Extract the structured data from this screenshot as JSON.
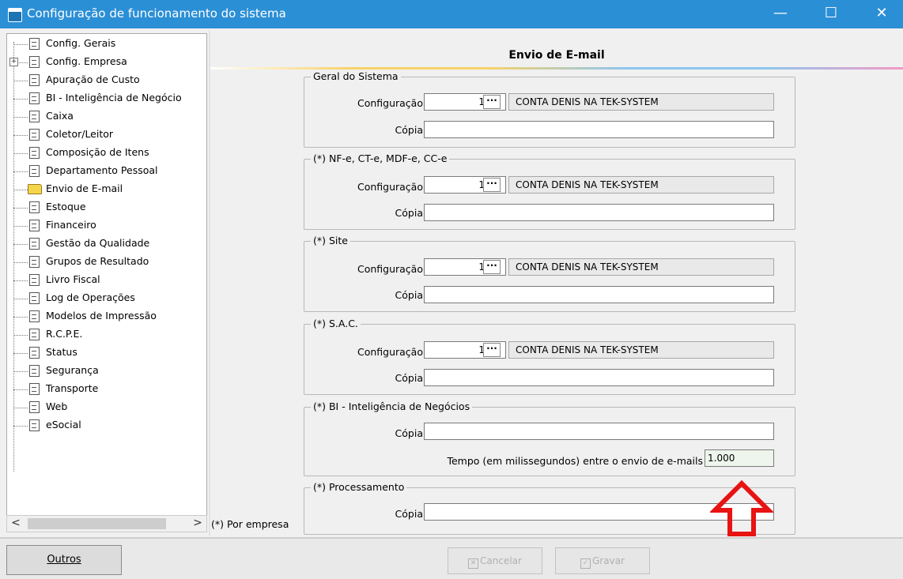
{
  "window": {
    "title": "Configuração de funcionamento do sistema",
    "minimize": "—",
    "maximize": "☐",
    "close": "✕"
  },
  "tree": {
    "items": [
      {
        "label": "Config. Gerais",
        "icon": "document-icon"
      },
      {
        "label": "Config. Empresa",
        "icon": "document-icon",
        "expander": "+"
      },
      {
        "label": "Apuração de Custo",
        "icon": "document-icon"
      },
      {
        "label": "BI - Inteligência de Negócio",
        "icon": "document-icon"
      },
      {
        "label": "Caixa",
        "icon": "document-icon"
      },
      {
        "label": "Coletor/Leitor",
        "icon": "document-icon"
      },
      {
        "label": "Composição de Itens",
        "icon": "document-icon"
      },
      {
        "label": "Departamento Pessoal",
        "icon": "document-icon"
      },
      {
        "label": "Envio de E-mail",
        "icon": "open-folder-icon",
        "selected": true
      },
      {
        "label": "Estoque",
        "icon": "document-icon"
      },
      {
        "label": "Financeiro",
        "icon": "document-icon"
      },
      {
        "label": "Gestão da Qualidade",
        "icon": "document-icon"
      },
      {
        "label": "Grupos de Resultado",
        "icon": "document-icon"
      },
      {
        "label": "Livro Fiscal",
        "icon": "document-icon"
      },
      {
        "label": "Log de Operações",
        "icon": "document-icon"
      },
      {
        "label": "Modelos de Impressão",
        "icon": "document-icon"
      },
      {
        "label": "R.C.P.E.",
        "icon": "document-icon"
      },
      {
        "label": "Status",
        "icon": "document-icon"
      },
      {
        "label": "Segurança",
        "icon": "document-icon"
      },
      {
        "label": "Transporte",
        "icon": "document-icon"
      },
      {
        "label": "Web",
        "icon": "document-icon"
      },
      {
        "label": "eSocial",
        "icon": "document-icon"
      }
    ],
    "scroll_left": "<",
    "scroll_right": ">"
  },
  "panel": {
    "title": "Envio de E-mail",
    "footnote": "(*) Por empresa"
  },
  "groups": [
    {
      "label": "Geral do Sistema",
      "config_label": "Configuração",
      "config_value": "1",
      "dots": "···",
      "config_name": "CONTA DENIS NA TEK-SYSTEM",
      "copy_label": "Cópia",
      "copy_value": ""
    },
    {
      "label": "(*) NF-e, CT-e, MDF-e, CC-e",
      "config_label": "Configuração",
      "config_value": "1",
      "dots": "···",
      "config_name": "CONTA DENIS NA TEK-SYSTEM",
      "copy_label": "Cópia",
      "copy_value": ""
    },
    {
      "label": "(*) Site",
      "config_label": "Configuração",
      "config_value": "1",
      "dots": "···",
      "config_name": "CONTA DENIS NA TEK-SYSTEM",
      "copy_label": "Cópia",
      "copy_value": ""
    },
    {
      "label": "(*) S.A.C.",
      "config_label": "Configuração",
      "config_value": "1",
      "dots": "···",
      "config_name": "CONTA DENIS NA TEK-SYSTEM",
      "copy_label": "Cópia",
      "copy_value": ""
    }
  ],
  "bi_group": {
    "label": "(*) BI - Inteligência de Negócios",
    "copy_label": "Cópia",
    "copy_value": "",
    "interval_label": "Tempo (em milissegundos) entre o envio de e-mails",
    "interval_value": "1.000"
  },
  "proc_group": {
    "label": "(*) Processamento",
    "copy_label": "Cópia",
    "copy_value": ""
  },
  "buttons": {
    "others": "Outros",
    "cancel": "Cancelar",
    "save": "Gravar"
  },
  "annotation": {
    "icon": "red-up-arrow-icon",
    "color": "#e81313"
  }
}
